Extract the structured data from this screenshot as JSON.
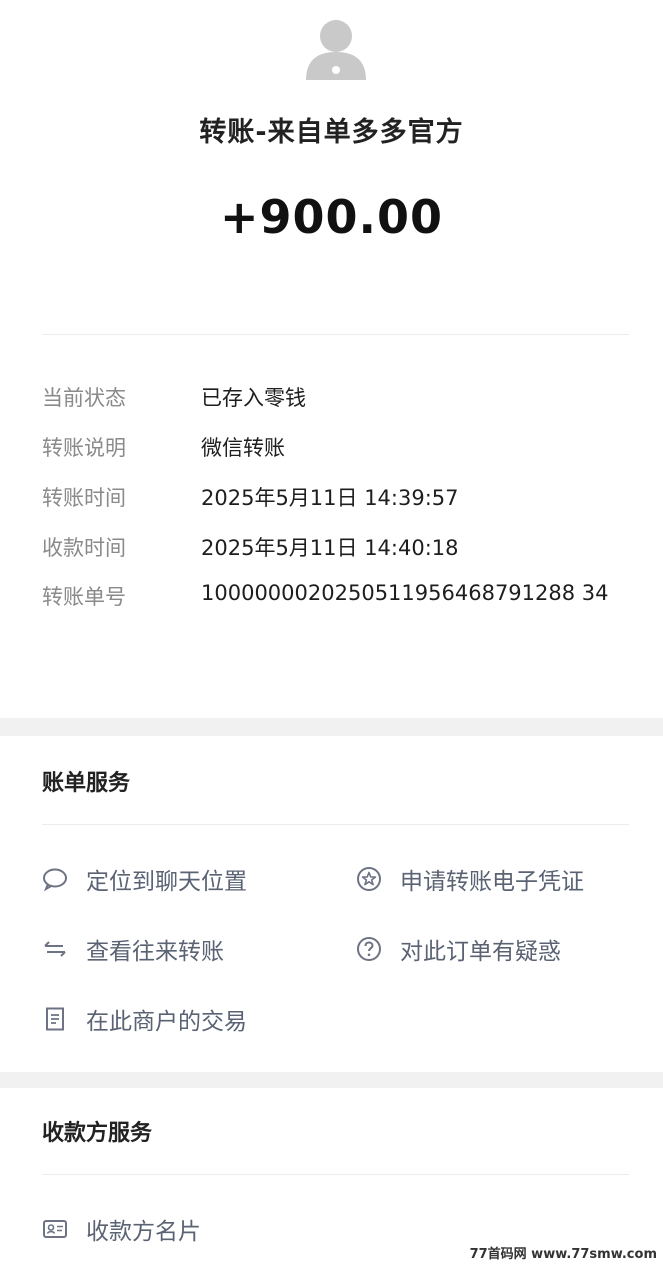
{
  "header": {
    "title": "转账-来自单多多官方",
    "amount": "+900.00"
  },
  "details": [
    {
      "label": "当前状态",
      "value": "已存入零钱"
    },
    {
      "label": "转账说明",
      "value": "微信转账"
    },
    {
      "label": "转账时间",
      "value": "2025年5月11日 14:39:57"
    },
    {
      "label": "收款时间",
      "value": "2025年5月11日 14:40:18"
    },
    {
      "label": "转账单号",
      "value": "1000000020250511956468791288 34"
    }
  ],
  "bill_services": {
    "title": "账单服务",
    "items": [
      {
        "label": "定位到聊天位置",
        "icon": "chat-bubble-icon"
      },
      {
        "label": "申请转账电子凭证",
        "icon": "star-badge-icon"
      },
      {
        "label": "查看往来转账",
        "icon": "swap-arrows-icon"
      },
      {
        "label": "对此订单有疑惑",
        "icon": "question-circle-icon"
      },
      {
        "label": "在此商户的交易",
        "icon": "receipt-icon"
      }
    ]
  },
  "payee_services": {
    "title": "收款方服务",
    "items": [
      {
        "label": "收款方名片",
        "icon": "id-card-icon"
      }
    ]
  },
  "watermark": "77首码网 www.77smw.com"
}
